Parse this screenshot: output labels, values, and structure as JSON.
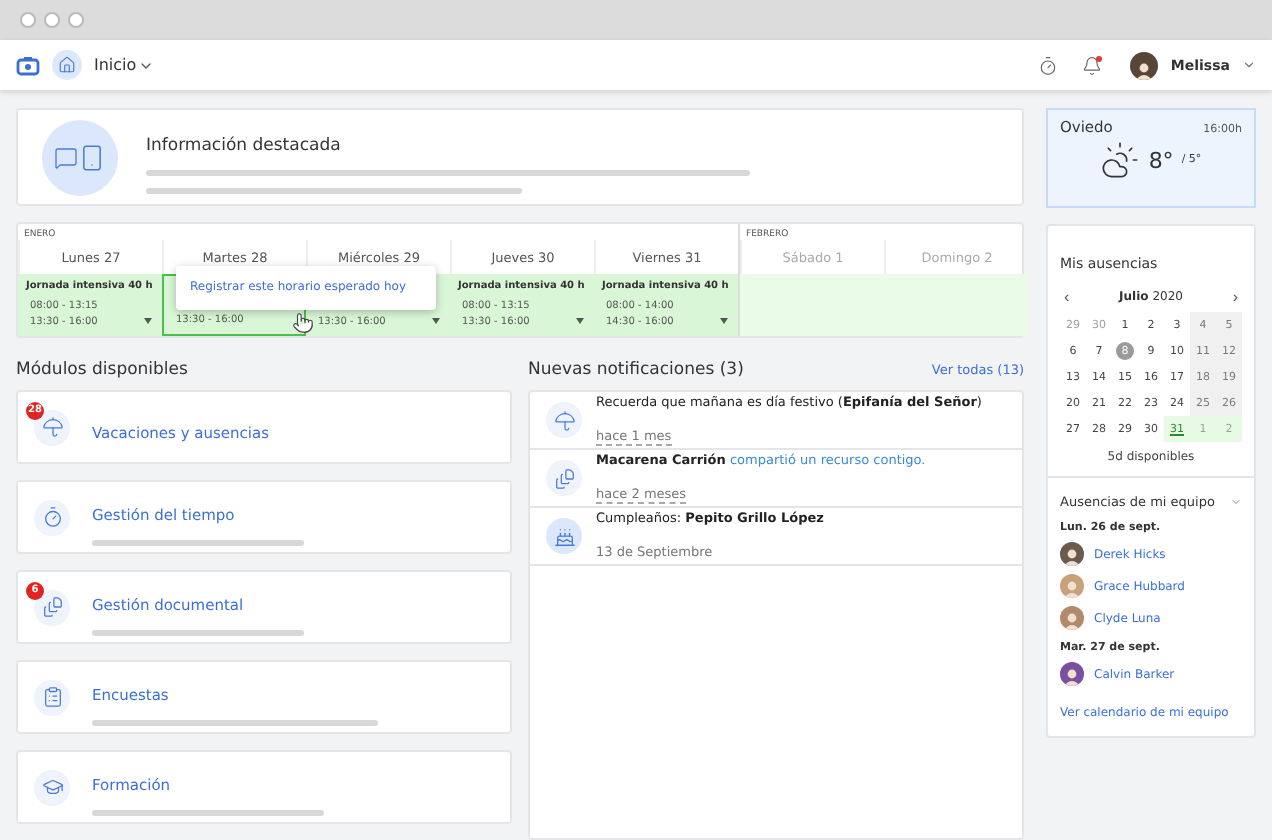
{
  "nav": {
    "section": "Inicio",
    "user": "Melissa",
    "notification_dot": true
  },
  "featured": {
    "title": "Información destacada"
  },
  "schedule": {
    "tooltip": "Registrar este horario esperado hoy",
    "months": [
      {
        "label": "ENERO",
        "days": [
          {
            "label": "Lunes 27",
            "kind": "work",
            "selected": false,
            "shift": "Jornada intensiva 40 h",
            "times": [
              "08:00 - 13:15",
              "13:30 - 16:00"
            ]
          },
          {
            "label": "Martes 28",
            "kind": "work",
            "selected": true,
            "times": [
              "13:30 - 16:00"
            ]
          },
          {
            "label": "Miércoles 29",
            "kind": "work",
            "selected": false,
            "times": [
              "13:30 - 16:00"
            ]
          },
          {
            "label": "Jueves 30",
            "kind": "work",
            "selected": false,
            "shift": "Jornada intensiva 40 h",
            "times": [
              "08:00 - 13:15",
              "13:30 - 16:00"
            ]
          },
          {
            "label": "Viernes 31",
            "kind": "work",
            "selected": false,
            "shift": "Jornada intensiva 40 h",
            "times": [
              "08:00 - 14:00",
              "14:30 - 16:00"
            ]
          }
        ]
      },
      {
        "label": "FEBRERO",
        "days": [
          {
            "label": "Sábado 1",
            "kind": "off",
            "selected": false
          },
          {
            "label": "Domingo 2",
            "kind": "off",
            "selected": false
          }
        ]
      }
    ]
  },
  "modules": {
    "title": "Módulos disponibles",
    "items": [
      {
        "title": "Vacaciones y ausencias",
        "kind": "vacation",
        "badge": "28"
      },
      {
        "title": "Gestión del tiempo",
        "kind": "time"
      },
      {
        "title": "Gestión documental",
        "kind": "documents",
        "badge": "6"
      },
      {
        "title": "Encuestas",
        "kind": "surveys"
      },
      {
        "title": "Formación",
        "kind": "training"
      }
    ]
  },
  "notifications": {
    "title": "Nuevas notificaciones (3)",
    "see_all": "Ver todas (13)",
    "items": [
      {
        "kind": "holiday",
        "text": "Recuerda que mañana es día festivo (**Epifanía del Señor**)",
        "time": "hace 1 mes"
      },
      {
        "kind": "share",
        "text": "**Macarena Carrión**",
        "link": "compartió un recurso contigo.",
        "time": "hace 2 meses"
      },
      {
        "kind": "birthday",
        "text": "Cumpleaños: **Pepito Grillo López**",
        "date": "13 de Septiembre"
      }
    ]
  },
  "weather": {
    "city": "Oviedo",
    "time": "16:00h",
    "high": "8°",
    "low": "/ 5°"
  },
  "absences": {
    "title": "Mis ausencias",
    "month": "Julio",
    "year": "2020",
    "prev": "‹",
    "next": "›",
    "available": "5d disponibles",
    "weeks": [
      [
        {
          "d": "29",
          "kind": "day",
          "muted": true
        },
        {
          "d": "30",
          "kind": "day",
          "muted": true
        },
        {
          "d": "1",
          "kind": "day",
          "muted": false
        },
        {
          "d": "2",
          "kind": "day",
          "muted": false
        },
        {
          "d": "3",
          "kind": "day",
          "muted": false
        },
        {
          "d": "4",
          "kind": "weekend",
          "muted": false
        },
        {
          "d": "5",
          "kind": "weekend",
          "muted": false
        }
      ],
      [
        {
          "d": "6",
          "kind": "day",
          "muted": false
        },
        {
          "d": "7",
          "kind": "day",
          "muted": false
        },
        {
          "d": "8",
          "kind": "today",
          "muted": false
        },
        {
          "d": "9",
          "kind": "day",
          "muted": false
        },
        {
          "d": "10",
          "kind": "day",
          "muted": false
        },
        {
          "d": "11",
          "kind": "weekend",
          "muted": false
        },
        {
          "d": "12",
          "kind": "weekend",
          "muted": false
        }
      ],
      [
        {
          "d": "13",
          "kind": "day",
          "muted": false
        },
        {
          "d": "14",
          "kind": "day",
          "muted": false
        },
        {
          "d": "15",
          "kind": "day",
          "muted": false
        },
        {
          "d": "16",
          "kind": "day",
          "muted": false
        },
        {
          "d": "17",
          "kind": "day",
          "muted": false
        },
        {
          "d": "18",
          "kind": "weekend",
          "muted": false
        },
        {
          "d": "19",
          "kind": "weekend",
          "muted": false
        }
      ],
      [
        {
          "d": "20",
          "kind": "day",
          "muted": false
        },
        {
          "d": "21",
          "kind": "day",
          "muted": false
        },
        {
          "d": "22",
          "kind": "day",
          "muted": false
        },
        {
          "d": "23",
          "kind": "day",
          "muted": false
        },
        {
          "d": "24",
          "kind": "day",
          "muted": false
        },
        {
          "d": "25",
          "kind": "weekend",
          "muted": false
        },
        {
          "d": "26",
          "kind": "weekend",
          "muted": false
        }
      ],
      [
        {
          "d": "27",
          "kind": "day",
          "muted": false
        },
        {
          "d": "28",
          "kind": "day",
          "muted": false
        },
        {
          "d": "29",
          "kind": "day",
          "muted": false
        },
        {
          "d": "30",
          "kind": "day",
          "muted": false
        },
        {
          "d": "31",
          "kind": "available",
          "muted": false
        },
        {
          "d": "1",
          "kind": "available",
          "muted": true
        },
        {
          "d": "2",
          "kind": "available",
          "muted": true
        }
      ]
    ]
  },
  "team": {
    "title": "Ausencias de mi equipo",
    "link": "Ver calendario de mi equipo",
    "groups": [
      {
        "date": "Lun. 26 de sept.",
        "people": [
          "Derek Hicks",
          "Grace Hubbard",
          "Clyde Luna"
        ]
      },
      {
        "date": "Mar. 27 de sept.",
        "people": [
          "Calvin Barker"
        ]
      }
    ]
  }
}
